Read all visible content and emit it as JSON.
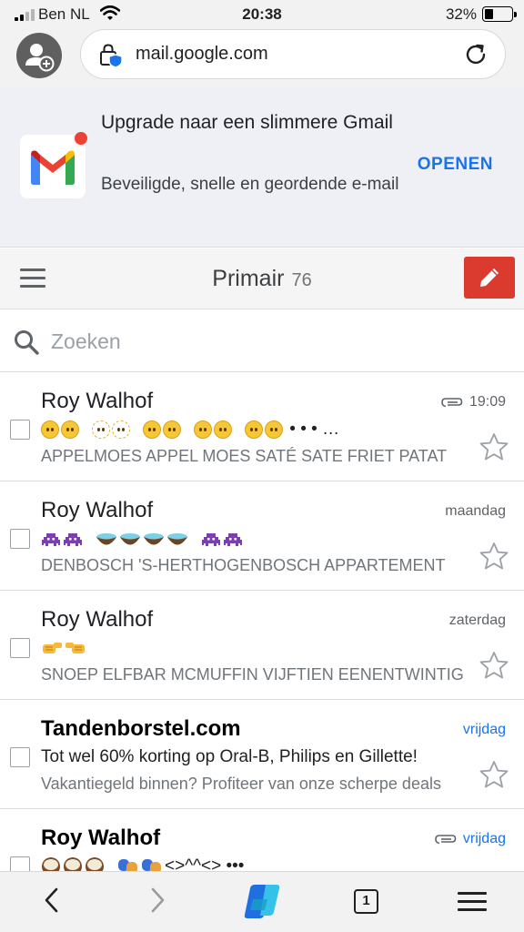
{
  "status_bar": {
    "carrier": "Ben NL",
    "time": "20:38",
    "battery_percent": "32%",
    "battery_level": 0.32,
    "icons": [
      "signal-icon",
      "wifi-icon",
      "battery-icon"
    ]
  },
  "browser": {
    "url": "mail.google.com",
    "icons": [
      "profile-add-icon",
      "lock-shield-icon",
      "reload-icon"
    ]
  },
  "promo": {
    "title": "Upgrade naar een slimmere Gmail",
    "subtitle": "Beveiligde, snelle en geordende e-mail",
    "open_label": "OPENEN",
    "icons": [
      "gmail-logo-icon"
    ]
  },
  "header": {
    "title": "Primair",
    "count": "76",
    "icons": [
      "menu-icon",
      "compose-pencil-icon"
    ]
  },
  "search": {
    "placeholder": "Zoeken",
    "value": ""
  },
  "emails": [
    {
      "sender": "Roy Walhof",
      "date": "19:09",
      "attachment": true,
      "unread": false,
      "line2_suffix": " • • • …",
      "snippet": "APPELMOES APPEL MOES SATÉ SATE FRIET PATAT"
    },
    {
      "sender": "Roy Walhof",
      "date": "maandag",
      "attachment": false,
      "unread": false,
      "snippet": "DENBOSCH 'S-HERTHOGENBOSCH APPARTEMENT"
    },
    {
      "sender": "Roy Walhof",
      "date": "zaterdag",
      "attachment": false,
      "unread": false,
      "snippet": "SNOEP ELFBAR MCMUFFIN VIJFTIEN EENENTWINTIG"
    },
    {
      "sender": "Tandenborstel.com",
      "date": "vrijdag",
      "attachment": false,
      "unread": true,
      "subject": "Tot wel 60% korting op Oral-B, Philips en Gillette!",
      "snippet": "Vakantiegeld binnen? Profiteer van onze scherpe deals"
    },
    {
      "sender": "Roy Walhof",
      "date": "vrijdag",
      "attachment": true,
      "unread": true,
      "line2_suffix": "<>^^<> •••"
    }
  ],
  "toolbar": {
    "tab_count": "1",
    "icons": [
      "back-icon",
      "forward-icon",
      "copilot-icon",
      "tabs-icon",
      "menu-icon"
    ]
  },
  "colors": {
    "accent_blue": "#1a73e8",
    "compose_red": "#db3b2f",
    "promo_bg": "#eef0f5",
    "chrome_bg": "#f2f2f2"
  }
}
